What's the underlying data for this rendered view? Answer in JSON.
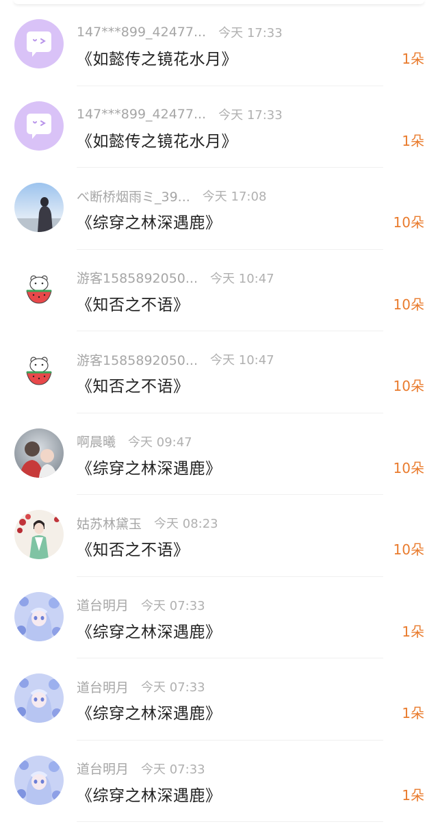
{
  "items": [
    {
      "username": "147***899_42477...",
      "time": "今天 17:33",
      "book": "《如懿传之镜花水月》",
      "amount": "1朵",
      "avatar": "chat-bubble-icon"
    },
    {
      "username": "147***899_42477...",
      "time": "今天 17:33",
      "book": "《如懿传之镜花水月》",
      "amount": "1朵",
      "avatar": "chat-bubble-icon"
    },
    {
      "username": "べ断桥烟雨ミ_39...",
      "time": "今天 17:08",
      "book": "《综穿之林深遇鹿》",
      "amount": "10朵",
      "avatar": "photo-avatar"
    },
    {
      "username": "游客1585892050...",
      "time": "今天 10:47",
      "book": "《知否之不语》",
      "amount": "10朵",
      "avatar": "watermelon-bear-avatar"
    },
    {
      "username": "游客1585892050...",
      "time": "今天 10:47",
      "book": "《知否之不语》",
      "amount": "10朵",
      "avatar": "watermelon-bear-avatar"
    },
    {
      "username": "啊晨曦",
      "time": "今天 09:47",
      "book": "《综穿之林深遇鹿》",
      "amount": "10朵",
      "avatar": "photo-avatar"
    },
    {
      "username": "姑苏林黛玉",
      "time": "今天 08:23",
      "book": "《知否之不语》",
      "amount": "10朵",
      "avatar": "illustrated-avatar"
    },
    {
      "username": "道台明月",
      "time": "今天 07:33",
      "book": "《综穿之林深遇鹿》",
      "amount": "1朵",
      "avatar": "anime-avatar"
    },
    {
      "username": "道台明月",
      "time": "今天 07:33",
      "book": "《综穿之林深遇鹿》",
      "amount": "1朵",
      "avatar": "anime-avatar"
    },
    {
      "username": "道台明月",
      "time": "今天 07:33",
      "book": "《综穿之林深遇鹿》",
      "amount": "1朵",
      "avatar": "anime-avatar"
    }
  ],
  "colors": {
    "amount": "#e97b2d",
    "username": "#a6a6a6",
    "book": "#222222",
    "chat_avatar_bg": "#d9c2f7"
  }
}
